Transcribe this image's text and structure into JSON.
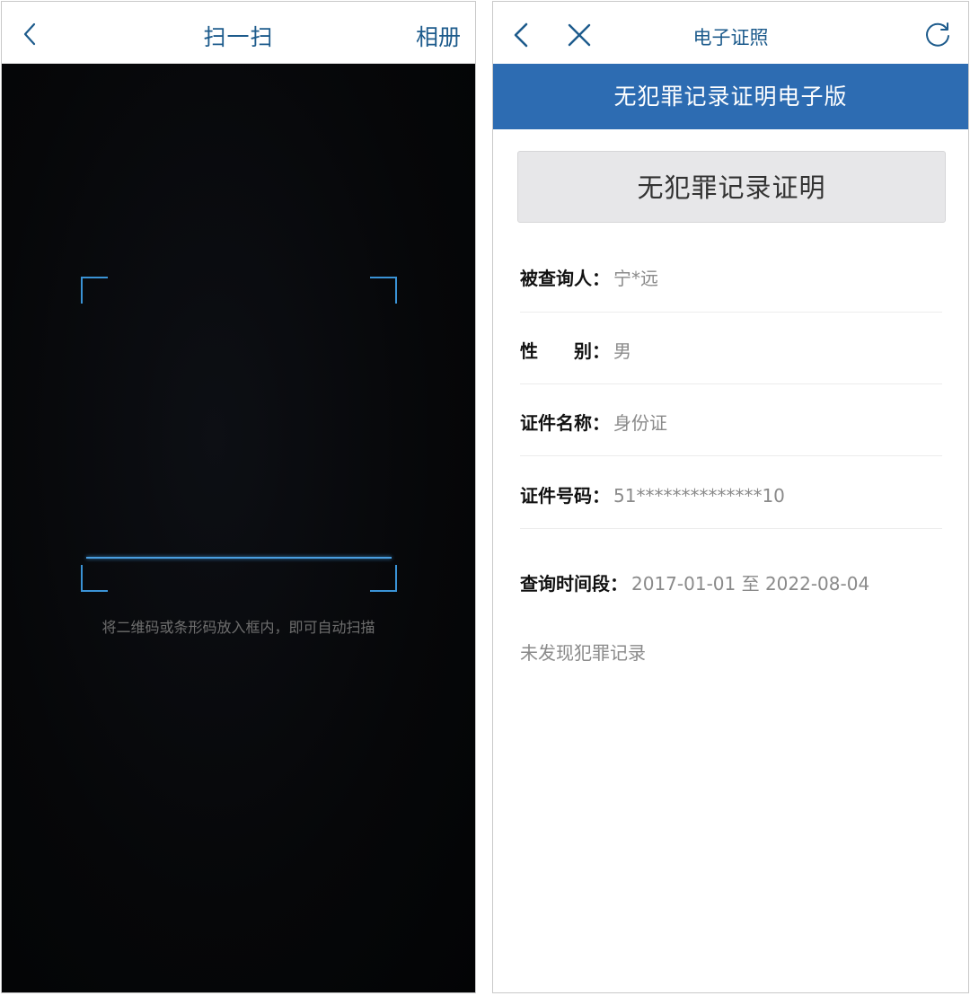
{
  "scanner": {
    "title": "扫一扫",
    "album_label": "相册",
    "hint": "将二维码或条形码放入框内，即可自动扫描",
    "accent_color": "#3a93d6"
  },
  "certificate": {
    "header_title": "电子证照",
    "banner_title": "无犯罪记录证明电子版",
    "card_title": "无犯罪记录证明",
    "fields": [
      {
        "label": "被查询人：",
        "value": "宁*远"
      },
      {
        "label": "性　　别：",
        "value": "男"
      },
      {
        "label": "证件名称：",
        "value": "身份证"
      },
      {
        "label": "证件号码：",
        "value": "51**************10"
      },
      {
        "label": "查询时间段：",
        "value": "2017-01-01 至 2022-08-04"
      }
    ],
    "status": "未发现犯罪记录",
    "banner_color": "#2d6cb2"
  }
}
